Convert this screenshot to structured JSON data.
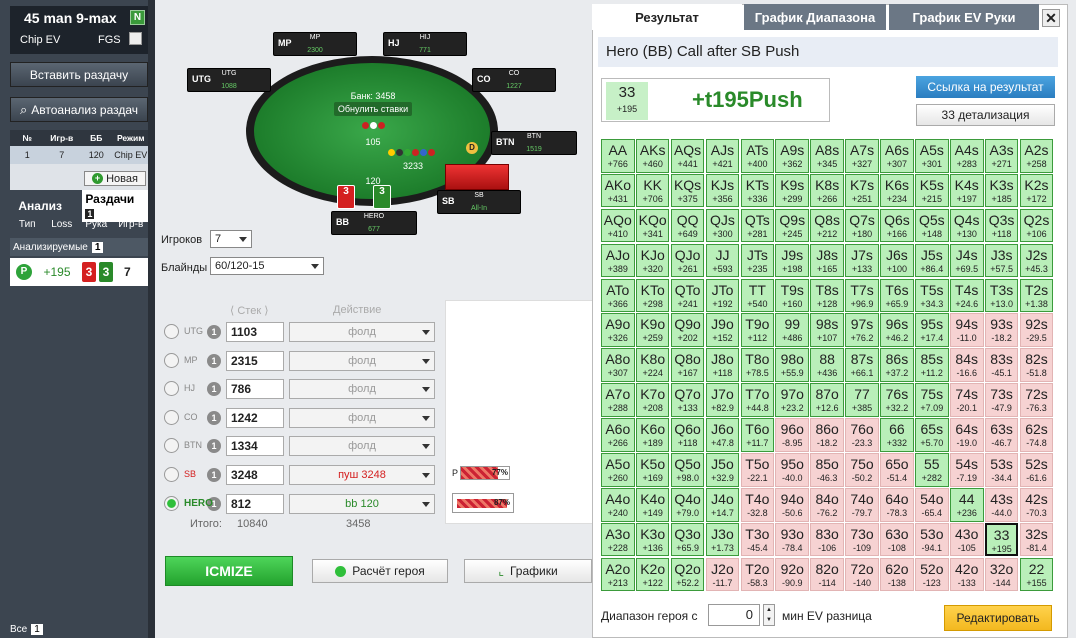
{
  "left_panel": {
    "title": "45 man 9-max",
    "title_badge": "N",
    "chip_ev": "Chip EV",
    "fgs": "FGS",
    "insert_hand": "Вставить раздачу",
    "autoanalysis": "Автоанализ раздач",
    "tourney_table": {
      "headers": [
        "№",
        "Игр-в",
        "ББ",
        "Режим"
      ],
      "row": [
        "1",
        "7",
        "120",
        "Chip EV"
      ]
    },
    "new_button": "Новая",
    "tab_analysis": "Анализ",
    "tab_hands": "Раздачи",
    "hands_count": "1",
    "col_headers": [
      "Тип",
      "Loss",
      "Рука",
      "Игр-в"
    ],
    "analyzed_label": "Анализируемые",
    "analyzed_count": "1",
    "hand_row": {
      "type": "P",
      "loss": "+195",
      "card1": "3",
      "card2": "3",
      "players": "7"
    },
    "all_label": "Все",
    "all_count": "1"
  },
  "table": {
    "bank_label": "Банк: 3458",
    "reset_label": "Обнулить ставки",
    "pot_top": "105",
    "pot_mid": "3233",
    "pot_bottom": "120",
    "dealer": "D",
    "seats": [
      {
        "pos": "MP",
        "name": "MP",
        "stack": "2300"
      },
      {
        "pos": "HJ",
        "name": "HIJ",
        "stack": "771"
      },
      {
        "pos": "UTG",
        "name": "UTG",
        "stack": "1088"
      },
      {
        "pos": "CO",
        "name": "CO",
        "stack": "1227"
      },
      {
        "pos": "BTN",
        "name": "BTN",
        "stack": "1519"
      },
      {
        "pos": "SB",
        "name": "SB",
        "stack": "All-In"
      },
      {
        "pos": "BB",
        "name": "HERO",
        "stack": "677"
      }
    ],
    "hero_cards": [
      "3",
      "3"
    ]
  },
  "form": {
    "players_label": "Игроков",
    "players_value": "7",
    "blinds_label": "Блайнды",
    "blinds_value": "60/120-15",
    "stack_header": "Стек",
    "action_header": "Действие",
    "rows": [
      {
        "num": "1",
        "pos": "UTG",
        "stack": "1103",
        "action": "фолд",
        "color": "#999999"
      },
      {
        "num": "1",
        "pos": "MP",
        "stack": "2315",
        "action": "фолд",
        "color": "#999999"
      },
      {
        "num": "1",
        "pos": "HJ",
        "stack": "786",
        "action": "фолд",
        "color": "#999999"
      },
      {
        "num": "1",
        "pos": "CO",
        "stack": "1242",
        "action": "фолд",
        "color": "#999999"
      },
      {
        "num": "1",
        "pos": "BTN",
        "stack": "1334",
        "action": "фолд",
        "color": "#999999"
      },
      {
        "num": "1",
        "pos": "SB",
        "stack": "3248",
        "action": "пуш 3248",
        "color": "#d42020"
      },
      {
        "num": "1",
        "pos": "HERO",
        "stack": "812",
        "action": "bb 120",
        "color": "#2a8a2a"
      }
    ],
    "total_label": "Итого:",
    "total_stack": "10840",
    "total_action": "3458",
    "bar1_label": "P",
    "bar1_pct": "77%",
    "bar2_pct": "87%",
    "icmize": "ICMIZE",
    "hero_calc": "Расчёт героя",
    "graphs": "Графики"
  },
  "right_panel": {
    "tabs": [
      "Результат",
      "График Диапазона",
      "График EV Руки"
    ],
    "header": "Hero (BB) Call after SB Push",
    "result_hand": "33",
    "result_ev": "+195",
    "result_big": "+t195Push",
    "link_button": "Ссылка на результат",
    "detail_button": "33 детализация",
    "range_label": "Диапазон героя с",
    "range_value": "0",
    "range_suffix": "мин EV разница",
    "edit_button": "Редактировать",
    "grid": [
      [
        "AA|+766|g",
        "AKs|+460|g",
        "AQs|+441|g",
        "AJs|+421|g",
        "ATs|+400|g",
        "A9s|+362|g",
        "A8s|+345|g",
        "A7s|+327|g",
        "A6s|+307|g",
        "A5s|+301|g",
        "A4s|+283|g",
        "A3s|+271|g",
        "A2s|+258|g"
      ],
      [
        "AKo|+431|g",
        "KK|+706|g",
        "KQs|+375|g",
        "KJs|+356|g",
        "KTs|+336|g",
        "K9s|+299|g",
        "K8s|+266|g",
        "K7s|+251|g",
        "K6s|+234|g",
        "K5s|+215|g",
        "K4s|+197|g",
        "K3s|+185|g",
        "K2s|+172|g"
      ],
      [
        "AQo|+410|g",
        "KQo|+341|g",
        "QQ|+649|g",
        "QJs|+300|g",
        "QTs|+281|g",
        "Q9s|+245|g",
        "Q8s|+212|g",
        "Q7s|+180|g",
        "Q6s|+166|g",
        "Q5s|+148|g",
        "Q4s|+130|g",
        "Q3s|+118|g",
        "Q2s|+106|g"
      ],
      [
        "AJo|+389|g",
        "KJo|+320|g",
        "QJo|+261|g",
        "JJ|+593|g",
        "JTs|+235|g",
        "J9s|+198|g",
        "J8s|+165|g",
        "J7s|+133|g",
        "J6s|+100|g",
        "J5s|+86.4|g",
        "J4s|+69.5|g",
        "J3s|+57.5|g",
        "J2s|+45.3|g"
      ],
      [
        "ATo|+366|g",
        "KTo|+298|g",
        "QTo|+241|g",
        "JTo|+192|g",
        "TT|+540|g",
        "T9s|+160|g",
        "T8s|+128|g",
        "T7s|+96.9|g",
        "T6s|+65.9|g",
        "T5s|+34.3|g",
        "T4s|+24.6|g",
        "T3s|+13.0|g",
        "T2s|+1.38|g"
      ],
      [
        "A9o|+326|g",
        "K9o|+259|g",
        "Q9o|+202|g",
        "J9o|+152|g",
        "T9o|+112|g",
        "99|+486|g",
        "98s|+107|g",
        "97s|+76.2|g",
        "96s|+46.2|g",
        "95s|+17.4|g",
        "94s|-11.0|r",
        "93s|-18.2|r",
        "92s|-29.5|r"
      ],
      [
        "A8o|+307|g",
        "K8o|+224|g",
        "Q8o|+167|g",
        "J8o|+118|g",
        "T8o|+78.5|g",
        "98o|+55.9|g",
        "88|+436|g",
        "87s|+66.1|g",
        "86s|+37.2|g",
        "85s|+11.2|g",
        "84s|-16.6|r",
        "83s|-45.1|r",
        "82s|-51.8|r"
      ],
      [
        "A7o|+288|g",
        "K7o|+208|g",
        "Q7o|+133|g",
        "J7o|+82.9|g",
        "T7o|+44.8|g",
        "97o|+23.2|g",
        "87o|+12.6|g",
        "77|+385|g",
        "76s|+32.2|g",
        "75s|+7.09|g",
        "74s|-20.1|r",
        "73s|-47.9|r",
        "72s|-76.3|r"
      ],
      [
        "A6o|+266|g",
        "K6o|+189|g",
        "Q6o|+118|g",
        "J6o|+47.8|g",
        "T6o|+11.7|g",
        "96o|-8.95|r",
        "86o|-18.2|r",
        "76o|-23.3|r",
        "66|+332|g",
        "65s|+5.70|g",
        "64s|-19.0|r",
        "63s|-46.7|r",
        "62s|-74.8|r"
      ],
      [
        "A5o|+260|g",
        "K5o|+169|g",
        "Q5o|+98.0|g",
        "J5o|+32.9|g",
        "T5o|-22.1|r",
        "95o|-40.0|r",
        "85o|-46.3|r",
        "75o|-50.2|r",
        "65o|-51.4|r",
        "55|+282|g",
        "54s|-7.19|r",
        "53s|-34.4|r",
        "52s|-61.6|r"
      ],
      [
        "A4o|+240|g",
        "K4o|+149|g",
        "Q4o|+79.0|g",
        "J4o|+14.7|g",
        "T4o|-32.8|r",
        "94o|-50.6|r",
        "84o|-76.2|r",
        "74o|-79.7|r",
        "64o|-78.3|r",
        "54o|-65.4|r",
        "44|+236|g",
        "43s|-44.0|r",
        "42s|-70.3|r"
      ],
      [
        "A3o|+228|g",
        "K3o|+136|g",
        "Q3o|+65.9|g",
        "J3o|+1.73|g",
        "T3o|-45.4|r",
        "93o|-78.4|r",
        "83o|-106|r",
        "73o|-109|r",
        "63o|-108|r",
        "53o|-94.1|r",
        "43o|-105|r",
        "33|+195|h",
        "32s|-81.4|r"
      ],
      [
        "A2o|+213|g",
        "K2o|+122|g",
        "Q2o|+52.2|g",
        "J2o|-11.7|r",
        "T2o|-58.3|r",
        "92o|-90.9|r",
        "82o|-114|r",
        "72o|-140|r",
        "62o|-138|r",
        "52o|-123|r",
        "42o|-133|r",
        "32o|-144|r",
        "22|+155|g"
      ]
    ]
  },
  "colors": {
    "green_cell": "#b9efb9",
    "red_cell": "#f6d2d2",
    "accent": "#2b7dc0"
  }
}
